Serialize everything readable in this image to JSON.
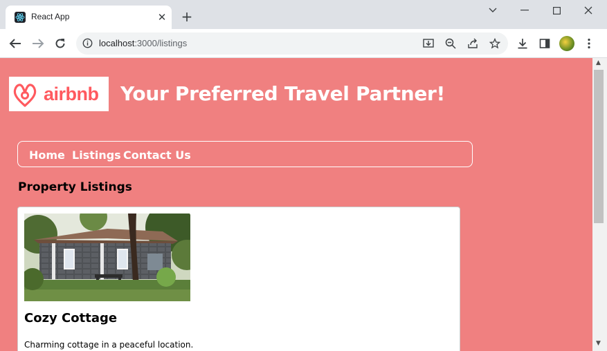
{
  "browser": {
    "tab_title": "React App",
    "url_host": "localhost",
    "url_rest": ":3000/listings"
  },
  "icons": {
    "favicon": "react-atom-icon",
    "tab_close": "close-icon",
    "new_tab": "plus-icon",
    "back": "arrow-left-icon",
    "forward": "arrow-right-icon",
    "reload": "reload-icon",
    "site_info": "info-icon",
    "install": "install-app-icon",
    "zoom": "zoom-out-icon",
    "share": "share-icon",
    "bookmark": "star-icon",
    "downloads": "download-icon",
    "side_panel": "side-panel-icon",
    "menu": "kebab-menu-icon"
  },
  "page": {
    "logo_text": "airbnb",
    "headline": "Your Preferred Travel Partner!",
    "nav": [
      "Home",
      "Listings",
      "Contact Us"
    ],
    "section_title": "Property Listings",
    "listings": [
      {
        "title": "Cozy Cottage",
        "description": "Charming cottage in a peaceful location."
      }
    ]
  },
  "colors": {
    "page_bg": "#f08080",
    "brand": "#ff5a5f",
    "nav_text": "#ffffff"
  }
}
